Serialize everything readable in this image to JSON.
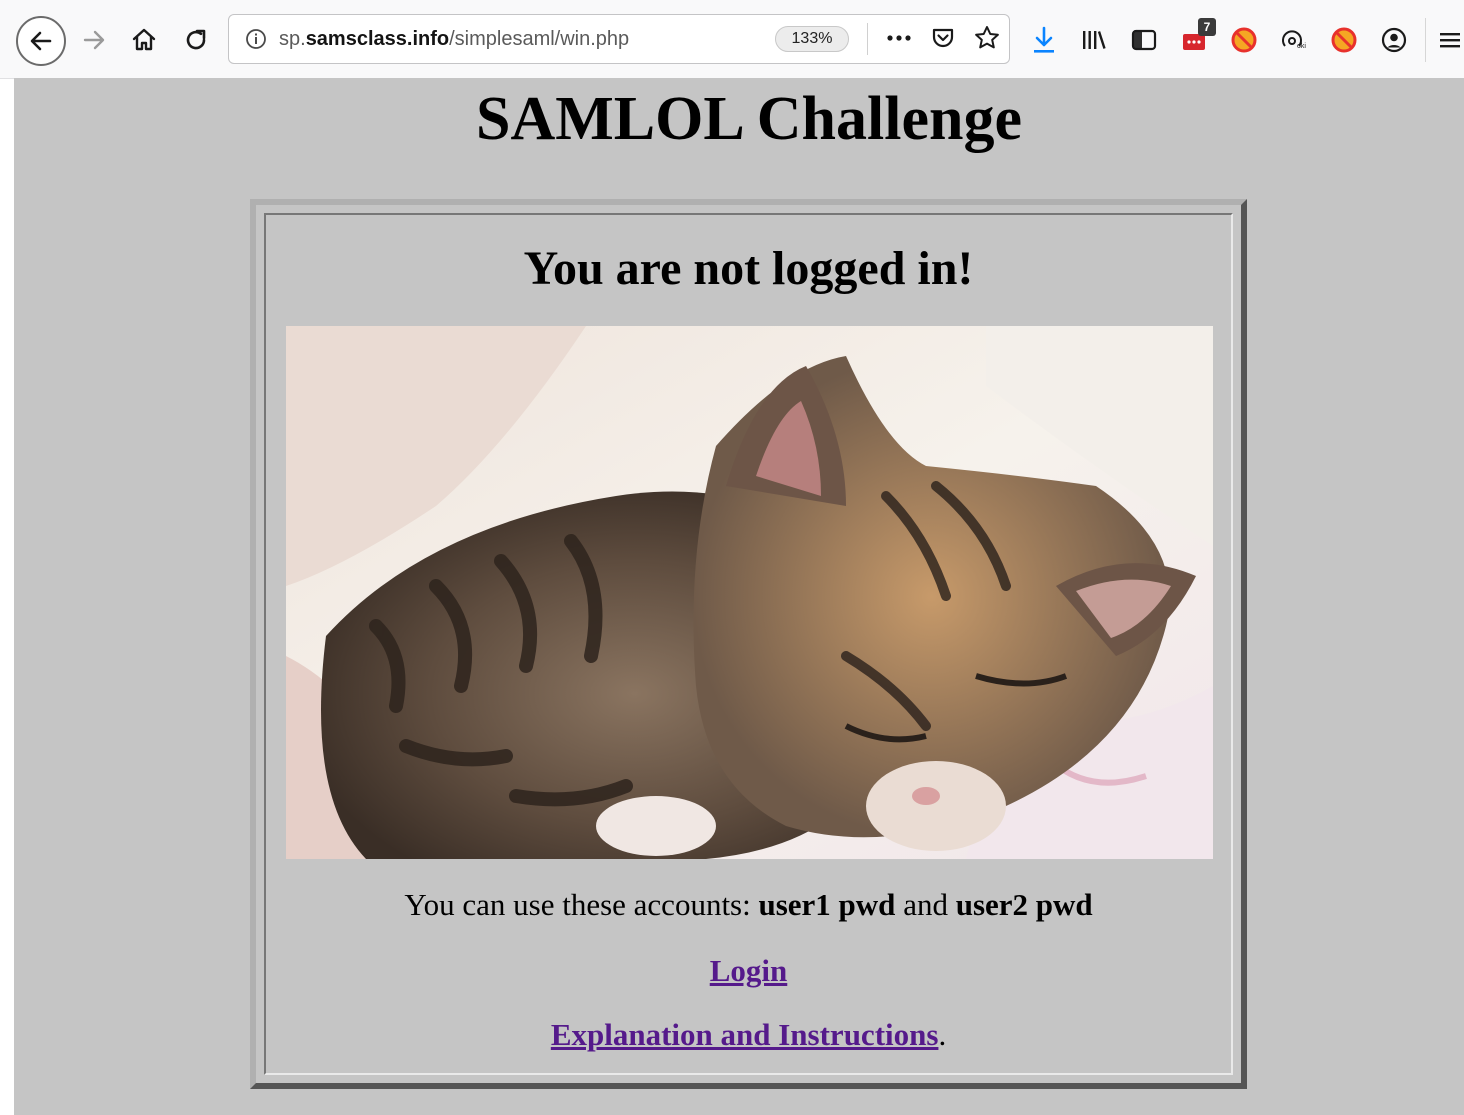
{
  "browser": {
    "url_prefix": "sp.",
    "url_domain": "samsclass.info",
    "url_path": "/simplesaml/win.php",
    "zoom": "133%",
    "extension_badge_count": "7"
  },
  "page": {
    "title": "SAMLOL Challenge",
    "status_heading": "You are not logged in!",
    "accounts_prefix": "You can use these accounts: ",
    "account1": "user1 pwd",
    "accounts_and": " and ",
    "account2": "user2 pwd",
    "login_link": "Login",
    "instructions_link": "Explanation and Instructions",
    "instructions_period": "."
  },
  "colors": {
    "page_background": "#c5c5c5",
    "visited_link": "#551a8b",
    "download_icon": "#0a84ff",
    "blocker_icon": "#e8312c"
  },
  "icons": [
    "back-icon",
    "forward-icon",
    "home-icon",
    "reload-icon",
    "info-icon",
    "page-actions-icon",
    "pocket-icon",
    "bookmark-star-icon",
    "download-icon",
    "library-icon",
    "sidebar-icon",
    "extension-badge-icon",
    "blocker-icon",
    "keyword-icon",
    "account-icon",
    "menu-icon"
  ]
}
